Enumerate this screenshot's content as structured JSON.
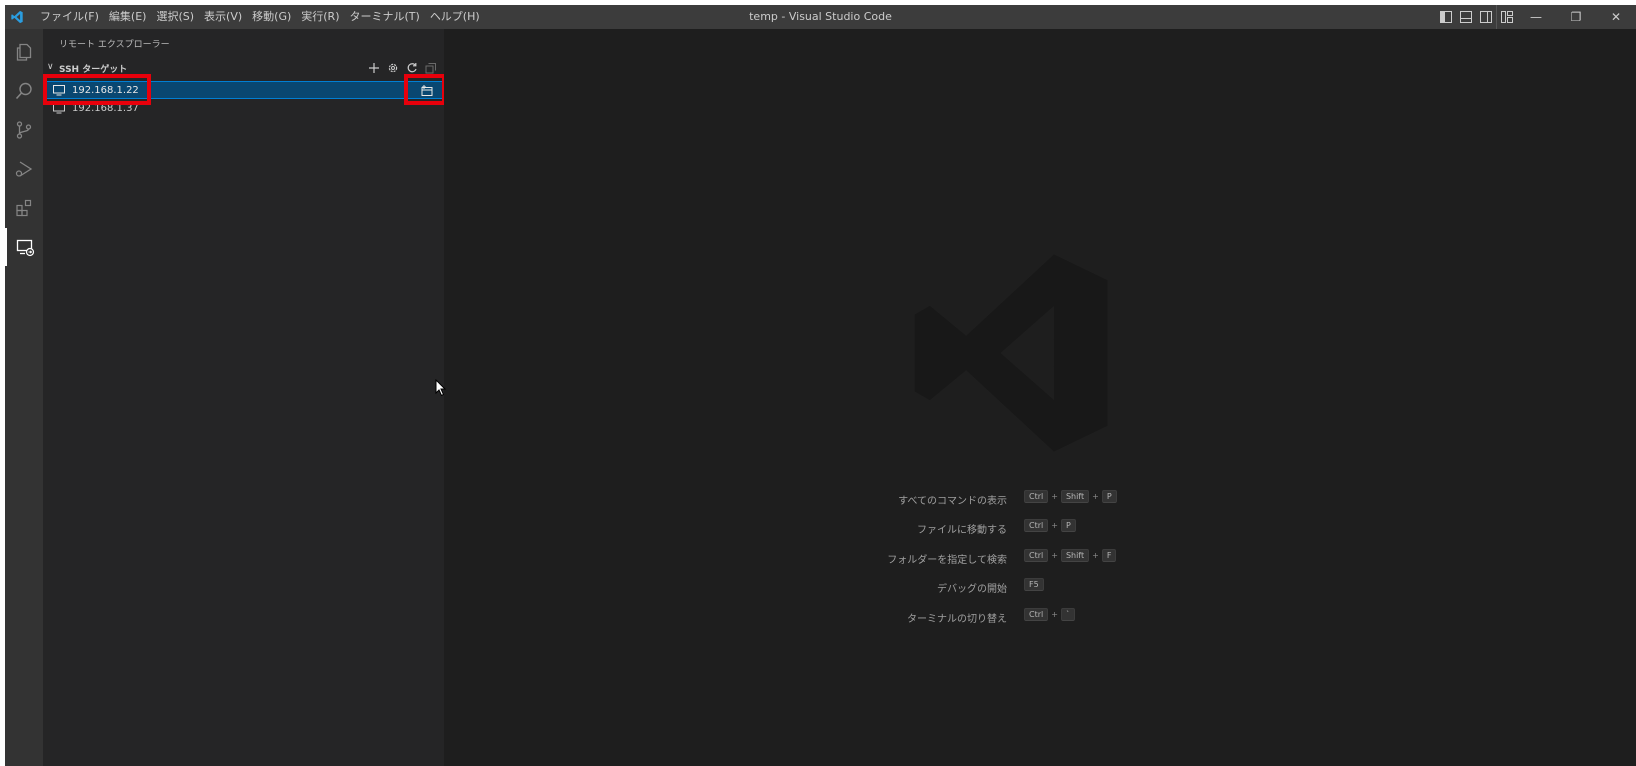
{
  "titlebar": {
    "title": "temp - Visual Studio Code",
    "menus": [
      "ファイル(F)",
      "編集(E)",
      "選択(S)",
      "表示(V)",
      "移動(G)",
      "実行(R)",
      "ターミナル(T)",
      "ヘルプ(H)"
    ],
    "window_controls": {
      "minimize": "—",
      "restore": "❐",
      "close": "✕"
    }
  },
  "activitybar": {
    "items": [
      "explorer-icon",
      "search-icon",
      "source-control-icon",
      "run-debug-icon",
      "extensions-icon",
      "remote-explorer-icon"
    ],
    "active": "remote-explorer-icon"
  },
  "sidebar": {
    "title": "リモート エクスプローラー",
    "section": {
      "chevron": "∨",
      "title": "SSH ターゲット",
      "actions": [
        "add-icon",
        "settings-gear-icon",
        "refresh-icon",
        "collapse-all-icon"
      ]
    },
    "hosts": [
      {
        "label": "192.168.1.22",
        "selected": true
      },
      {
        "label": "192.168.1.37",
        "selected": false
      }
    ],
    "row_action": "connect-new-window-icon"
  },
  "editor": {
    "watermark": "vscode-logo-icon",
    "shortcuts": [
      {
        "label": "すべてのコマンドの表示",
        "keys": [
          "Ctrl",
          "Shift",
          "P"
        ]
      },
      {
        "label": "ファイルに移動する",
        "keys": [
          "Ctrl",
          "P"
        ]
      },
      {
        "label": "フォルダーを指定して検索",
        "keys": [
          "Ctrl",
          "Shift",
          "F"
        ]
      },
      {
        "label": "デバッグの開始",
        "keys": [
          "F5"
        ]
      },
      {
        "label": "ターミナルの切り替え",
        "keys": [
          "Ctrl",
          "`"
        ]
      }
    ]
  },
  "colors": {
    "accent": "#007acc",
    "selection": "#094771",
    "highlight": "#e8000b"
  }
}
